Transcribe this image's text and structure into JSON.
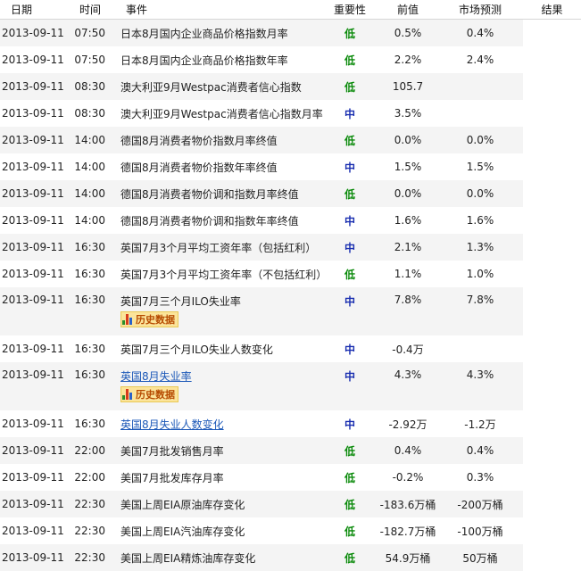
{
  "header": {
    "date": "日期",
    "time": "时间",
    "event": "事件",
    "importance": "重要性",
    "previous": "前值",
    "forecast": "市场预测",
    "result": "结果"
  },
  "importance_colors": {
    "低": "#0a8a0a",
    "中": "#1a2fb0"
  },
  "history_button_label": "历史数据",
  "history_icon": "bar-chart-icon",
  "rows": [
    {
      "date": "2013-09-11",
      "time": "07:50",
      "event": "日本8月国内企业商品价格指数月率",
      "importance": "低",
      "previous": "0.5%",
      "forecast": "0.4%",
      "result": "",
      "link": false,
      "history": false
    },
    {
      "date": "2013-09-11",
      "time": "07:50",
      "event": "日本8月国内企业商品价格指数年率",
      "importance": "低",
      "previous": "2.2%",
      "forecast": "2.4%",
      "result": "",
      "link": false,
      "history": false
    },
    {
      "date": "2013-09-11",
      "time": "08:30",
      "event": "澳大利亚9月Westpac消费者信心指数",
      "importance": "低",
      "previous": "105.7",
      "forecast": "",
      "result": "",
      "link": false,
      "history": false
    },
    {
      "date": "2013-09-11",
      "time": "08:30",
      "event": "澳大利亚9月Westpac消费者信心指数月率",
      "importance": "中",
      "previous": "3.5%",
      "forecast": "",
      "result": "",
      "link": false,
      "history": false
    },
    {
      "date": "2013-09-11",
      "time": "14:00",
      "event": "德国8月消费者物价指数月率终值",
      "importance": "低",
      "previous": "0.0%",
      "forecast": "0.0%",
      "result": "",
      "link": false,
      "history": false
    },
    {
      "date": "2013-09-11",
      "time": "14:00",
      "event": "德国8月消费者物价指数年率终值",
      "importance": "中",
      "previous": "1.5%",
      "forecast": "1.5%",
      "result": "",
      "link": false,
      "history": false
    },
    {
      "date": "2013-09-11",
      "time": "14:00",
      "event": "德国8月消费者物价调和指数月率终值",
      "importance": "低",
      "previous": "0.0%",
      "forecast": "0.0%",
      "result": "",
      "link": false,
      "history": false
    },
    {
      "date": "2013-09-11",
      "time": "14:00",
      "event": "德国8月消费者物价调和指数年率终值",
      "importance": "中",
      "previous": "1.6%",
      "forecast": "1.6%",
      "result": "",
      "link": false,
      "history": false
    },
    {
      "date": "2013-09-11",
      "time": "16:30",
      "event": "英国7月3个月平均工资年率（包括红利）",
      "importance": "中",
      "previous": "2.1%",
      "forecast": "1.3%",
      "result": "",
      "link": false,
      "history": false
    },
    {
      "date": "2013-09-11",
      "time": "16:30",
      "event": "英国7月3个月平均工资年率（不包括红利）",
      "importance": "低",
      "previous": "1.1%",
      "forecast": "1.0%",
      "result": "",
      "link": false,
      "history": false
    },
    {
      "date": "2013-09-11",
      "time": "16:30",
      "event": "英国7月三个月ILO失业率",
      "importance": "中",
      "previous": "7.8%",
      "forecast": "7.8%",
      "result": "",
      "link": false,
      "history": true
    },
    {
      "date": "2013-09-11",
      "time": "16:30",
      "event": "英国7月三个月ILO失业人数变化",
      "importance": "中",
      "previous": "-0.4万",
      "forecast": "",
      "result": "",
      "link": false,
      "history": false
    },
    {
      "date": "2013-09-11",
      "time": "16:30",
      "event": "英国8月失业率",
      "importance": "中",
      "previous": "4.3%",
      "forecast": "4.3%",
      "result": "",
      "link": true,
      "history": true
    },
    {
      "date": "2013-09-11",
      "time": "16:30",
      "event": "英国8月失业人数变化",
      "importance": "中",
      "previous": "-2.92万",
      "forecast": "-1.2万",
      "result": "",
      "link": true,
      "history": false
    },
    {
      "date": "2013-09-11",
      "time": "22:00",
      "event": "美国7月批发销售月率",
      "importance": "低",
      "previous": "0.4%",
      "forecast": "0.4%",
      "result": "",
      "link": false,
      "history": false
    },
    {
      "date": "2013-09-11",
      "time": "22:00",
      "event": "美国7月批发库存月率",
      "importance": "低",
      "previous": "-0.2%",
      "forecast": "0.3%",
      "result": "",
      "link": false,
      "history": false
    },
    {
      "date": "2013-09-11",
      "time": "22:30",
      "event": "美国上周EIA原油库存变化",
      "importance": "低",
      "previous": "-183.6万桶",
      "forecast": "-200万桶",
      "result": "",
      "link": false,
      "history": false
    },
    {
      "date": "2013-09-11",
      "time": "22:30",
      "event": "美国上周EIA汽油库存变化",
      "importance": "低",
      "previous": "-182.7万桶",
      "forecast": "-100万桶",
      "result": "",
      "link": false,
      "history": false
    },
    {
      "date": "2013-09-11",
      "time": "22:30",
      "event": "美国上周EIA精炼油库存变化",
      "importance": "低",
      "previous": "54.9万桶",
      "forecast": "50万桶",
      "result": "",
      "link": false,
      "history": false
    }
  ]
}
